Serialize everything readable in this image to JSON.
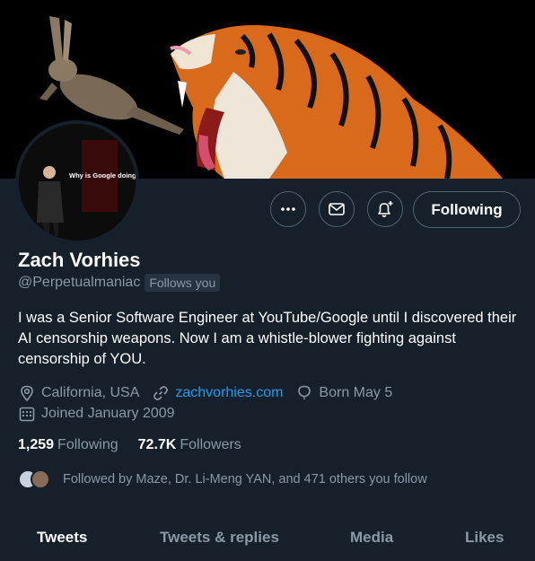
{
  "profile": {
    "name": "Zach Vorhies",
    "handle": "@Perpetualmaniac",
    "follows_you": "Follows you",
    "bio": "I was a Senior Software Engineer at YouTube/Google until I discovered their AI censorship weapons. Now I am a whistle-blower fighting against censorship of YOU.",
    "location": "California, USA",
    "website": "zachvorhies.com",
    "birthday": "Born May 5",
    "joined": "Joined January 2009",
    "avatar_caption": "Why is Google doing this?"
  },
  "actions": {
    "more_icon": "more-horizontal-icon",
    "message_icon": "envelope-icon",
    "notify_icon": "bell-plus-icon",
    "follow_label": "Following"
  },
  "stats": {
    "following_count": "1,259",
    "following_label": "Following",
    "followers_count": "72.7K",
    "followers_label": "Followers"
  },
  "followed_by": "Followed by Maze, Dr. Li-Meng YAN, and 471 others you follow",
  "tabs": [
    {
      "label": "Tweets",
      "active": true
    },
    {
      "label": "Tweets & replies",
      "active": false
    },
    {
      "label": "Media",
      "active": false
    },
    {
      "label": "Likes",
      "active": false
    }
  ],
  "colors": {
    "background": "#15202b",
    "accent": "#1d9bf0",
    "secondary_text": "#8b98a5",
    "border": "#536471"
  }
}
